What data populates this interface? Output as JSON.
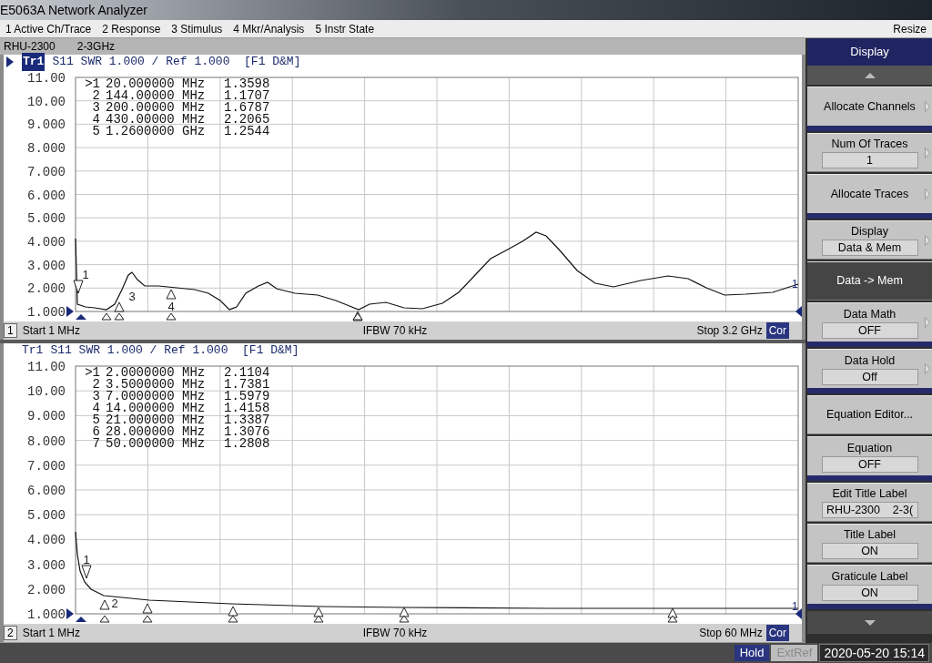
{
  "window": {
    "title": "E5063A Network Analyzer"
  },
  "menu": [
    {
      "label": "1 Active Ch/Trace"
    },
    {
      "label": "2 Response"
    },
    {
      "label": "3 Stimulus"
    },
    {
      "label": "4 Mkr/Analysis"
    },
    {
      "label": "5 Instr State"
    }
  ],
  "menu_right": "Resize",
  "channels": [
    {
      "title_label": [
        "RHU-2300",
        "2-3GHz"
      ],
      "active": true,
      "trace": "Tr1",
      "trace_info": "S11 SWR 1.000 / Ref 1.000  [F1 D&M]",
      "y_labels": [
        "11.00",
        "10.00",
        "9.000",
        "8.000",
        "7.000",
        "6.000",
        "5.000",
        "4.000",
        "3.000",
        "2.000",
        "1.000"
      ],
      "markers": [
        {
          "id": ">1",
          "stimulus": "20.000000 MHz",
          "value": "1.3598"
        },
        {
          "id": "2",
          "stimulus": "144.00000 MHz",
          "value": "1.1707"
        },
        {
          "id": "3",
          "stimulus": "200.00000 MHz",
          "value": "1.6787"
        },
        {
          "id": "4",
          "stimulus": "430.00000 MHz",
          "value": "2.2065"
        },
        {
          "id": "5",
          "stimulus": "1.2600000 GHz",
          "value": "1.2544"
        }
      ],
      "marker_labels": [
        "1",
        "3",
        "4"
      ],
      "trace_label": "1",
      "number": "1",
      "start": "Start 1 MHz",
      "ifbw": "IFBW 70 kHz",
      "stop": "Stop 3.2 GHz",
      "correction": "Cor"
    },
    {
      "active": false,
      "trace": "Tr1",
      "trace_info": "S11 SWR 1.000 / Ref 1.000  [F1 D&M]",
      "y_labels": [
        "11.00",
        "10.00",
        "9.000",
        "8.000",
        "7.000",
        "6.000",
        "5.000",
        "4.000",
        "3.000",
        "2.000",
        "1.000"
      ],
      "markers": [
        {
          "id": ">1",
          "stimulus": "2.0000000 MHz",
          "value": "2.1104"
        },
        {
          "id": "2",
          "stimulus": "3.5000000 MHz",
          "value": "1.7381"
        },
        {
          "id": "3",
          "stimulus": "7.0000000 MHz",
          "value": "1.5979"
        },
        {
          "id": "4",
          "stimulus": "14.000000 MHz",
          "value": "1.4158"
        },
        {
          "id": "5",
          "stimulus": "21.000000 MHz",
          "value": "1.3387"
        },
        {
          "id": "6",
          "stimulus": "28.000000 MHz",
          "value": "1.3076"
        },
        {
          "id": "7",
          "stimulus": "50.000000 MHz",
          "value": "1.2808"
        }
      ],
      "marker_labels": [
        "1",
        "2"
      ],
      "trace_label": "1",
      "number": "2",
      "start": "Start 1 MHz",
      "ifbw": "IFBW 70 kHz",
      "stop": "Stop 60 MHz",
      "correction": "Cor"
    }
  ],
  "softkeys": {
    "title": "Display",
    "items": [
      {
        "label": "Allocate Channels",
        "submenu": true,
        "selected": false,
        "separator_after": true
      },
      {
        "label": "Num Of Traces",
        "value": "1",
        "submenu": true,
        "selected": false,
        "separator_after": false
      },
      {
        "label": "Allocate Traces",
        "submenu": true,
        "selected": false,
        "separator_after": true
      },
      {
        "label": "Display",
        "value": "Data & Mem",
        "submenu": true,
        "selected": false,
        "separator_after": false
      },
      {
        "label": "Data -> Mem",
        "submenu": false,
        "selected": true,
        "separator_after": false
      },
      {
        "label": "Data Math",
        "value": "OFF",
        "submenu": true,
        "selected": false,
        "separator_after": true
      },
      {
        "label": "Data Hold",
        "value": "Off",
        "submenu": true,
        "selected": false,
        "separator_after": true
      },
      {
        "label": "Equation Editor...",
        "submenu": false,
        "selected": false,
        "separator_after": false
      },
      {
        "label": "Equation",
        "value": "OFF",
        "submenu": false,
        "selected": false,
        "separator_after": true
      },
      {
        "label": "Edit Title Label",
        "value": "RHU-2300    2-3(",
        "submenu": false,
        "selected": false,
        "separator_after": false
      },
      {
        "label": "Title Label",
        "value": "ON",
        "submenu": false,
        "selected": false,
        "separator_after": false
      },
      {
        "label": "Graticule Label",
        "value": "ON",
        "submenu": false,
        "selected": false,
        "separator_after": true
      }
    ]
  },
  "status_bar": {
    "indicators": [
      {
        "label": "Hold",
        "on": true
      },
      {
        "label": "ExtRef",
        "on": false
      }
    ],
    "datetime": "2020-05-20 15:14"
  }
}
